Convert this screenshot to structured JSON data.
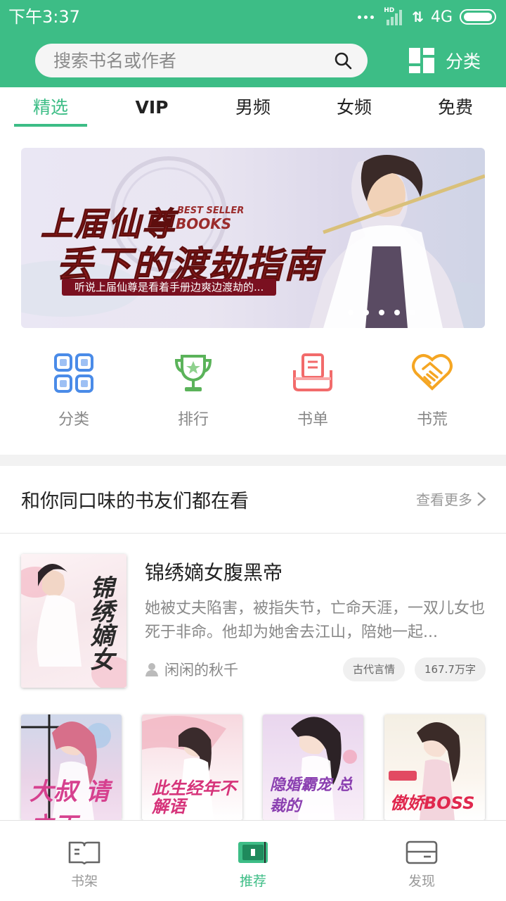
{
  "status_bar": {
    "time": "下午3:37",
    "network": "4G",
    "hd": "HD"
  },
  "search": {
    "placeholder": "搜索书名或作者"
  },
  "header": {
    "category_label": "分类"
  },
  "tabs": [
    {
      "label": "精选",
      "active": true
    },
    {
      "label": "VIP"
    },
    {
      "label": "男频"
    },
    {
      "label": "女频"
    },
    {
      "label": "免费"
    }
  ],
  "banner": {
    "title_line1": "上届仙尊",
    "title_line2": "丢下的渡劫指南",
    "badge_line1": "BEST SELLER",
    "badge_line2": "BOOKS",
    "subtitle": "听说上届仙尊是看着手册边爽边渡劫的...",
    "page_count": 5,
    "current_page": 1
  },
  "quick_links": [
    {
      "label": "分类",
      "icon": "grid-icon",
      "color": "#4a8be8"
    },
    {
      "label": "排行",
      "icon": "trophy-icon",
      "color": "#5bb35a"
    },
    {
      "label": "书单",
      "icon": "booklist-icon",
      "color": "#f26b6b"
    },
    {
      "label": "书荒",
      "icon": "handshake-icon",
      "color": "#f5a623"
    }
  ],
  "section": {
    "title": "和你同口味的书友们都在看",
    "more_label": "查看更多",
    "featured": {
      "title": "锦绣嫡女腹黑帝",
      "description": "她被丈夫陷害，被指失节，亡命天涯，一双儿女也死于非命。他却为她舍去江山，陪她一起...",
      "author": "闲闲的秋千",
      "tags": [
        "古代言情",
        "167.7万字"
      ],
      "cover_text": "锦绣嫡女"
    },
    "grid_covers": [
      {
        "cover_text": "大叔 请立正"
      },
      {
        "cover_text": "此生经年不解语"
      },
      {
        "cover_text": "隐婚霸宠 总裁的"
      },
      {
        "cover_text": "傲娇BOSS"
      }
    ]
  },
  "bottom_nav": [
    {
      "label": "书架",
      "icon": "bookshelf-icon"
    },
    {
      "label": "推荐",
      "icon": "recommend-icon",
      "active": true
    },
    {
      "label": "发现",
      "icon": "discover-icon"
    }
  ],
  "colors": {
    "brand": "#3dbd86",
    "text": "#222222",
    "muted": "#888888"
  }
}
